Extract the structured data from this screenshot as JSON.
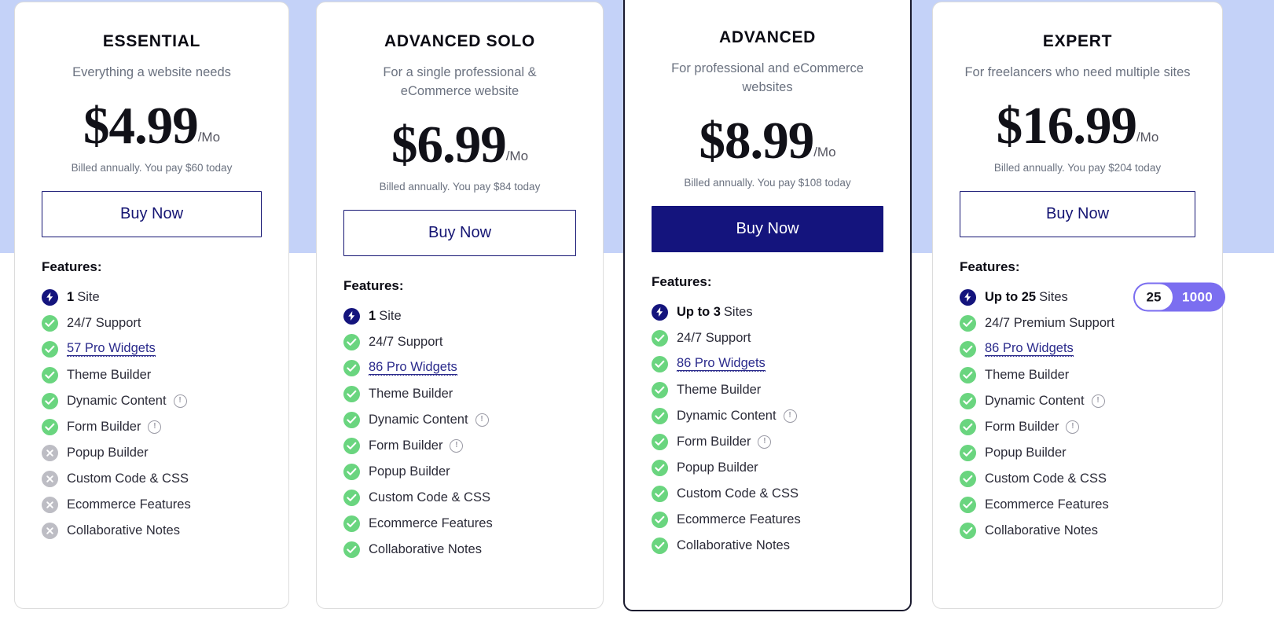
{
  "page": {
    "band_color": "#c4d2f8",
    "accent_navy": "#14147d",
    "accent_green": "#6ad57f",
    "accent_gray": "#bdbdc4",
    "accent_purple": "#7b6ef0"
  },
  "features_label": "Features:",
  "buy_label": "Buy Now",
  "per_label": "/Mo",
  "plans": [
    {
      "name": "ESSENTIAL",
      "desc": "Everything a website needs",
      "price": "$4.99",
      "billed": "Billed annually. You pay $60 today",
      "buy_label": "Buy Now",
      "highlight": false,
      "features": [
        {
          "icon": "bolt-icon",
          "strong": "1",
          "text": "Site"
        },
        {
          "icon": "check-icon",
          "text": "24/7 Support"
        },
        {
          "icon": "check-icon",
          "link": "57 Pro Widgets"
        },
        {
          "icon": "check-icon",
          "text": "Theme Builder"
        },
        {
          "icon": "check-icon",
          "text": "Dynamic Content",
          "info": true
        },
        {
          "icon": "check-icon",
          "text": "Form Builder",
          "info": true
        },
        {
          "icon": "cross-icon",
          "text": "Popup Builder"
        },
        {
          "icon": "cross-icon",
          "text": "Custom Code & CSS"
        },
        {
          "icon": "cross-icon",
          "text": "Ecommerce Features"
        },
        {
          "icon": "cross-icon",
          "text": "Collaborative Notes"
        }
      ]
    },
    {
      "name": "ADVANCED SOLO",
      "desc": "For a single professional & eCommerce website",
      "price": "$6.99",
      "billed": "Billed annually. You pay $84 today",
      "buy_label": "Buy Now",
      "highlight": false,
      "features": [
        {
          "icon": "bolt-icon",
          "strong": "1",
          "text": "Site"
        },
        {
          "icon": "check-icon",
          "text": "24/7 Support"
        },
        {
          "icon": "check-icon",
          "link": "86 Pro Widgets"
        },
        {
          "icon": "check-icon",
          "text": "Theme Builder"
        },
        {
          "icon": "check-icon",
          "text": "Dynamic Content",
          "info": true
        },
        {
          "icon": "check-icon",
          "text": "Form Builder",
          "info": true
        },
        {
          "icon": "check-icon",
          "text": "Popup Builder"
        },
        {
          "icon": "check-icon",
          "text": "Custom Code & CSS"
        },
        {
          "icon": "check-icon",
          "text": "Ecommerce Features"
        },
        {
          "icon": "check-icon",
          "text": "Collaborative Notes"
        }
      ]
    },
    {
      "name": "ADVANCED",
      "desc": "For professional and eCommerce websites",
      "price": "$8.99",
      "billed": "Billed annually. You pay $108 today",
      "buy_label": "Buy Now",
      "highlight": true,
      "features": [
        {
          "icon": "bolt-icon",
          "strong": "Up to 3",
          "text": "Sites"
        },
        {
          "icon": "check-icon",
          "text": "24/7 Support"
        },
        {
          "icon": "check-icon",
          "link": "86 Pro Widgets"
        },
        {
          "icon": "check-icon",
          "text": "Theme Builder"
        },
        {
          "icon": "check-icon",
          "text": "Dynamic Content",
          "info": true
        },
        {
          "icon": "check-icon",
          "text": "Form Builder",
          "info": true
        },
        {
          "icon": "check-icon",
          "text": "Popup Builder"
        },
        {
          "icon": "check-icon",
          "text": "Custom Code & CSS"
        },
        {
          "icon": "check-icon",
          "text": "Ecommerce Features"
        },
        {
          "icon": "check-icon",
          "text": "Collaborative Notes"
        }
      ]
    },
    {
      "name": "EXPERT",
      "desc": "For freelancers who need multiple sites",
      "price": "$16.99",
      "billed": "Billed annually. You pay $204 today",
      "buy_label": "Buy Now",
      "highlight": false,
      "site_toggle": {
        "selected": "25",
        "other": "1000"
      },
      "features": [
        {
          "icon": "bolt-icon",
          "strong": "Up to 25",
          "text": "Sites",
          "toggle": true
        },
        {
          "icon": "check-icon",
          "text": "24/7 Premium Support"
        },
        {
          "icon": "check-icon",
          "link": "86 Pro Widgets"
        },
        {
          "icon": "check-icon",
          "text": "Theme Builder"
        },
        {
          "icon": "check-icon",
          "text": "Dynamic Content",
          "info": true
        },
        {
          "icon": "check-icon",
          "text": "Form Builder",
          "info": true
        },
        {
          "icon": "check-icon",
          "text": "Popup Builder"
        },
        {
          "icon": "check-icon",
          "text": "Custom Code & CSS"
        },
        {
          "icon": "check-icon",
          "text": "Ecommerce Features"
        },
        {
          "icon": "check-icon",
          "text": "Collaborative Notes"
        }
      ]
    }
  ]
}
